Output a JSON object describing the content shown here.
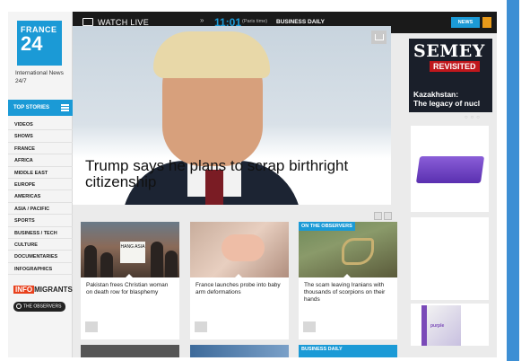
{
  "brand": {
    "line1": "FRANCE",
    "line2": "24",
    "tagline": "International News 24/7",
    "color": "#1b9ad6"
  },
  "topbar": {
    "watch_live": "WATCH LIVE",
    "chevron": "»",
    "clock": "11:01",
    "paris_time": "(Paris time)",
    "program": "BUSINESS DAILY",
    "news_button": "NEWS"
  },
  "sidebar": {
    "top_stories": "TOP STORIES",
    "items": [
      "VIDEOS",
      "SHOWS",
      "FRANCE",
      "AFRICA",
      "MIDDLE EAST",
      "EUROPE",
      "AMERICAS",
      "ASIA / PACIFIC",
      "SPORTS",
      "BUSINESS / TECH",
      "CULTURE",
      "DOCUMENTARIES",
      "INFOGRAPHICS"
    ],
    "infomigrants_a": "INFO",
    "infomigrants_b": "MIGRANTS",
    "observers": "THE OBSERVERS"
  },
  "hero": {
    "title": "Trump says he plans to scrap birthright citizenship"
  },
  "cards": [
    {
      "caption": "Pakistan frees Christian woman on death row for blasphemy",
      "sign": "HANG ASIA"
    },
    {
      "caption": "France launches probe into baby arm deformations"
    },
    {
      "caption": "The scam leaving Iranians with thousands of scorpions on their hands",
      "tag": "ON THE OBSERVERS"
    }
  ],
  "bottom_strip": {
    "label": "BUSINESS DAILY"
  },
  "ad": {
    "title": "SEMEY",
    "subtitle": "REVISITED",
    "kicker_line1": "Kazakhstan:",
    "kicker_line2": "The legacy of nucl",
    "purple_label": "purple"
  }
}
